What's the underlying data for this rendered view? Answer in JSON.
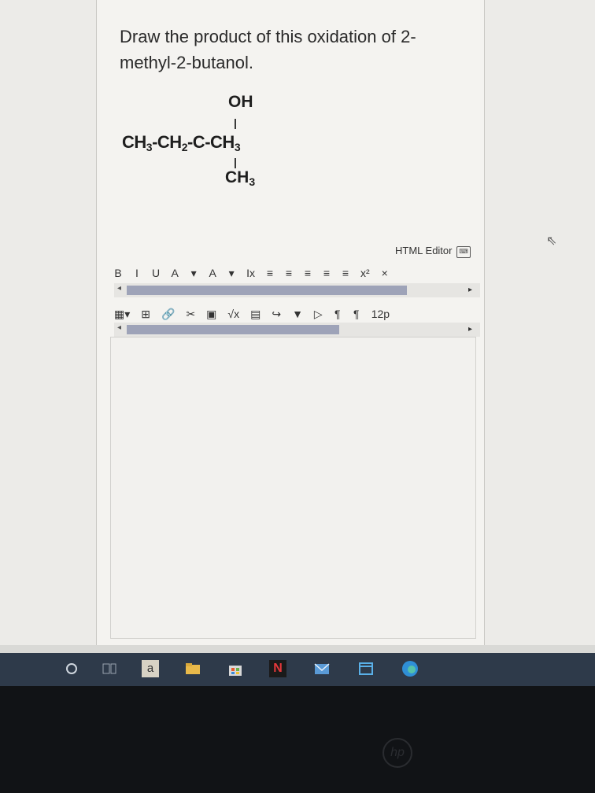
{
  "question": {
    "line1": "Draw the product of this oxidation of 2-",
    "line2": "methyl-2-butanol."
  },
  "structure": {
    "top": "OH",
    "main_prefix": "CH",
    "main_sub1": "3",
    "main_mid1": "-CH",
    "main_sub2": "2",
    "main_mid2": "-C-CH",
    "main_sub3": "3",
    "bottom": "CH",
    "bottom_sub": "3"
  },
  "editor": {
    "label": "HTML Editor",
    "toolbar1": [
      "B",
      "I",
      "U",
      "A",
      "▾",
      "A",
      "▾",
      "Ix",
      "≡",
      "≡",
      "≡",
      "≡",
      "≡",
      "x²",
      "×"
    ],
    "toolbar2": [
      "▦▾",
      "⊞",
      "🔗",
      "✂",
      "▣",
      "√x",
      "▤",
      "↪",
      "▼",
      "▷",
      "¶",
      "¶",
      "12p"
    ],
    "font_size": "12p"
  },
  "taskbar": {
    "search_letter": "a",
    "netflix_letter": "N"
  },
  "colors": {
    "panel": "#f4f3f0",
    "scroll_thumb": "#9ea3b8",
    "taskbar": "#2e3a4a"
  }
}
